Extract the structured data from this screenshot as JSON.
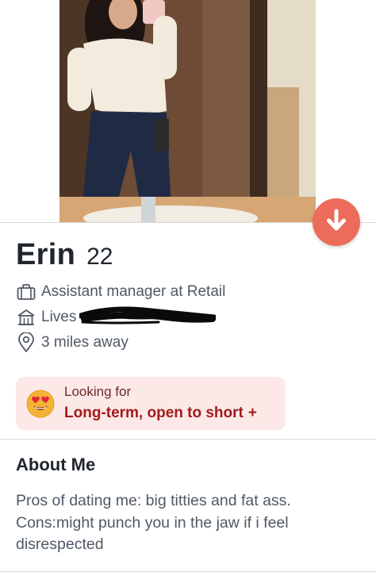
{
  "profile": {
    "name": "Erin",
    "age": "22",
    "job": "Assistant manager at Retail",
    "lives_prefix": "Lives",
    "distance": "3 miles away"
  },
  "looking_for": {
    "label": "Looking for",
    "value": "Long-term, open to short",
    "plus": "+"
  },
  "about": {
    "title": "About Me",
    "text": "Pros of dating me: big titties and fat ass. Cons:might punch you in the jaw if i feel disrespected"
  },
  "icons": {
    "down_button": "arrow-down-icon",
    "job": "briefcase-icon",
    "lives": "house-icon",
    "distance": "location-pin-icon",
    "looking": "heart-eyes-emoji-icon"
  },
  "colors": {
    "down_button": "#ec6b5a",
    "looking_bg": "#fde8e8",
    "looking_value": "#a11b1b",
    "text_primary": "#21262e",
    "text_secondary": "#505965"
  }
}
